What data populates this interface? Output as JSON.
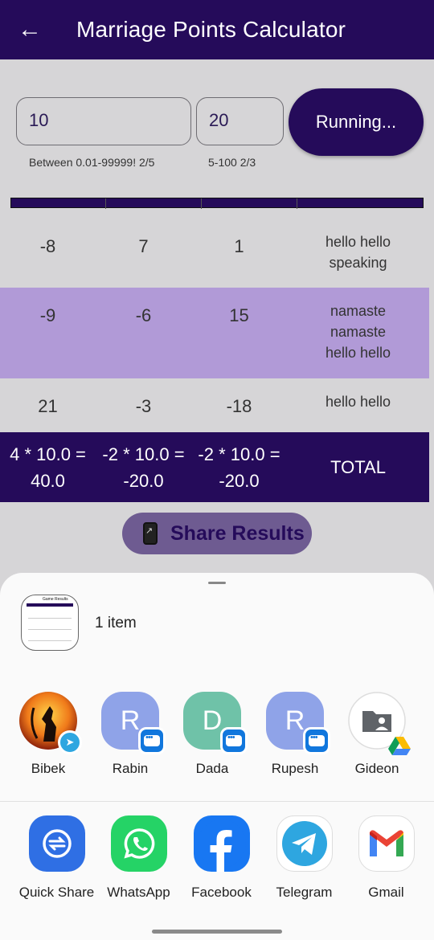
{
  "app": {
    "title": "Marriage Points Calculator",
    "back_icon": "arrow-left-icon"
  },
  "inputs": {
    "amount_value": "10",
    "amount_helper": "Between 0.01-99999! 2/5",
    "percent_value": "20",
    "percent_helper": "5-100   2/3",
    "run_label": "Running..."
  },
  "table": {
    "rows": [
      {
        "c1": "-8",
        "c2": "7",
        "c3": "1",
        "name_lines": [
          "hello hello",
          "speaking"
        ]
      },
      {
        "c1": "-9",
        "c2": "-6",
        "c3": "15",
        "name_lines": [
          "namaste",
          "namaste",
          "hello hello"
        ]
      },
      {
        "c1": "21",
        "c2": "-3",
        "c3": "-18",
        "name_lines": [
          "hello hello"
        ]
      }
    ],
    "totals": [
      {
        "line1": "4 * 10.0 =",
        "line2": "40.0"
      },
      {
        "line1": "-2 * 10.0 =",
        "line2": "-20.0"
      },
      {
        "line1": "-2 * 10.0 =",
        "line2": "-20.0"
      }
    ],
    "total_label": "TOTAL"
  },
  "share_button": {
    "label": "Share Results",
    "icon": "share-phone-icon"
  },
  "share_sheet": {
    "preview_title": "Game Results",
    "item_count": "1 item",
    "contacts": [
      {
        "name": "Bibek",
        "initial": "",
        "color": "#e8641b",
        "badge": "telegram"
      },
      {
        "name": "Rabin",
        "initial": "R",
        "color": "#8fa3e8",
        "badge": "messages"
      },
      {
        "name": "Dada",
        "initial": "D",
        "color": "#6fc2a8",
        "badge": "messages"
      },
      {
        "name": "Rupesh",
        "initial": "R",
        "color": "#8fa3e8",
        "badge": "messages"
      },
      {
        "name": "Gideon",
        "initial": "",
        "color": "#ffffff",
        "badge": "drive"
      }
    ],
    "apps": [
      {
        "name": "Quick Share",
        "icon": "quick-share-icon",
        "color": "#2f6fe4"
      },
      {
        "name": "WhatsApp",
        "icon": "whatsapp-icon",
        "color": "#25d366"
      },
      {
        "name": "Facebook",
        "icon": "facebook-icon",
        "color": "#1877f2"
      },
      {
        "name": "Telegram",
        "icon": "telegram-icon",
        "color": "#2ea6e0"
      },
      {
        "name": "Gmail",
        "icon": "gmail-icon",
        "color": "#ffffff"
      }
    ]
  },
  "colors": {
    "primary": "#250b5a",
    "highlight_row": "#b19ad7",
    "background": "#d6d5d7"
  }
}
